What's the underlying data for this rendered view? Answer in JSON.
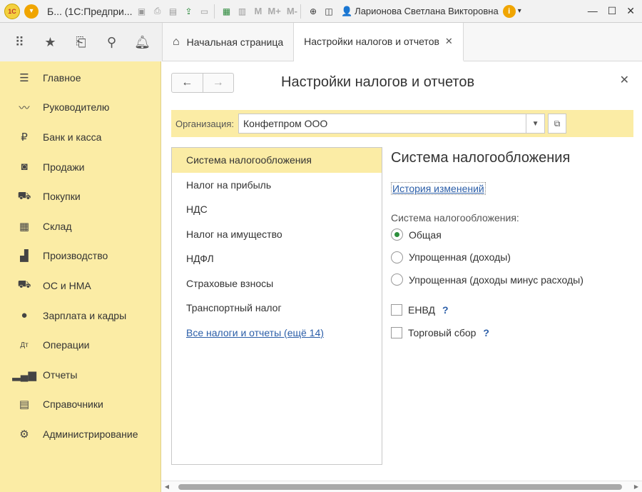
{
  "titlebar": {
    "title": "Б... (1С:Предпри...",
    "m_labels": [
      "M",
      "M+",
      "M-"
    ],
    "user": "Ларионова Светлана Викторовна"
  },
  "tabs": [
    {
      "label": "Начальная страница"
    },
    {
      "label": "Настройки налогов и отчетов"
    }
  ],
  "sidebar": {
    "items": [
      {
        "label": "Главное",
        "icon": "menu-lines-icon"
      },
      {
        "label": "Руководителю",
        "icon": "trend-line-icon"
      },
      {
        "label": "Банк и касса",
        "icon": "ruble-icon"
      },
      {
        "label": "Продажи",
        "icon": "shopping-bag-icon"
      },
      {
        "label": "Покупки",
        "icon": "shopping-cart-icon"
      },
      {
        "label": "Склад",
        "icon": "warehouse-grid-icon"
      },
      {
        "label": "Производство",
        "icon": "factory-icon"
      },
      {
        "label": "ОС и НМА",
        "icon": "truck-icon"
      },
      {
        "label": "Зарплата и кадры",
        "icon": "person-icon"
      },
      {
        "label": "Операции",
        "icon": "dt-kt-icon"
      },
      {
        "label": "Отчеты",
        "icon": "bar-chart-icon"
      },
      {
        "label": "Справочники",
        "icon": "books-icon"
      },
      {
        "label": "Администрирование",
        "icon": "gear-icon"
      }
    ]
  },
  "page": {
    "title": "Настройки налогов и отчетов",
    "org_label": "Организация:",
    "org_value": "Конфетпром ООО"
  },
  "list": {
    "items": [
      {
        "label": "Система налогообложения"
      },
      {
        "label": "Налог на прибыль"
      },
      {
        "label": "НДС"
      },
      {
        "label": "Налог на имущество"
      },
      {
        "label": "НДФЛ"
      },
      {
        "label": "Страховые взносы"
      },
      {
        "label": "Транспортный налог"
      }
    ],
    "all_link": "Все налоги и отчеты (ещё 14)"
  },
  "detail": {
    "title": "Система налогообложения",
    "history_link": "История изменений",
    "tax_system_label": "Система налогообложения:",
    "options": [
      {
        "label": "Общая",
        "checked": true
      },
      {
        "label": "Упрощенная (доходы)",
        "checked": false
      },
      {
        "label": "Упрощенная (доходы минус расходы)",
        "checked": false
      }
    ],
    "checkboxes": [
      {
        "label": "ЕНВД",
        "help": "?"
      },
      {
        "label": "Торговый сбор",
        "help": "?"
      }
    ]
  },
  "colors": {
    "sidebar_bg": "#fbeca5",
    "selected_bg": "#fbeca5",
    "link": "#2b5ea8",
    "radio_checked": "#2d8f3c"
  }
}
